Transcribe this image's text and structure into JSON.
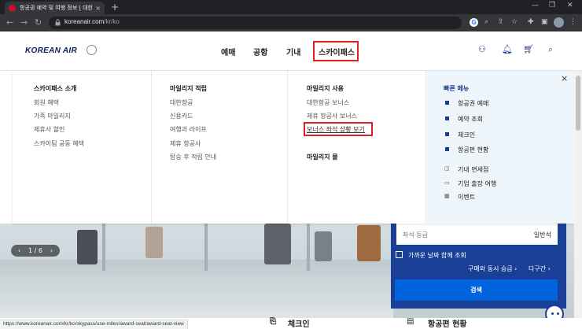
{
  "browser": {
    "tab_title": "항공권 예약 및 여행 정보 | 대한항공",
    "tab_close": "×",
    "new_tab": "+",
    "url_domain": "koreanair.com",
    "url_path": "/kr/ko",
    "status_url": "https://www.koreanair.com/kr/ko/skypass/use-miles/award-seat/award-seat-view"
  },
  "header": {
    "logo": "KOREAN AIR",
    "nav": [
      "예매",
      "공항",
      "기내",
      "스카이패스"
    ]
  },
  "mega_menu": {
    "col1": {
      "heading": "스카이패스 소개",
      "items": [
        "회원 혜택",
        "가족 마일리지",
        "제휴사 할인",
        "스카이팀 공동 혜택"
      ]
    },
    "col2": {
      "heading": "마일리지 적립",
      "items": [
        "대한항공",
        "신용카드",
        "여행과 라이프",
        "제휴 항공사",
        "탑승 후 적립 안내"
      ]
    },
    "col3": {
      "heading": "마일리지 사용",
      "items": [
        "대한항공 보너스",
        "제휴 항공사 보너스",
        "보너스 좌석 상황 보기"
      ],
      "heading2": "마일리지 몰"
    },
    "quick": {
      "title": "빠른 메뉴",
      "primary": [
        "항공권 예매",
        "예약 조회",
        "체크인",
        "항공편 현황"
      ],
      "secondary": [
        "기내 면세점",
        "기업 출장 여행",
        "이벤트"
      ]
    },
    "close": "×"
  },
  "booking": {
    "seat_label": "좌석 등급",
    "seat_value": "일반석",
    "nearby_dates": "가까운 날짜 함께 조회",
    "combo": "구매와 동시 승급 ›",
    "multi": "다구간 ›",
    "search": "검색"
  },
  "hero": {
    "pager": "1 / 6"
  },
  "bottom": {
    "checkin": "체크인",
    "status": "항공편 현황"
  }
}
